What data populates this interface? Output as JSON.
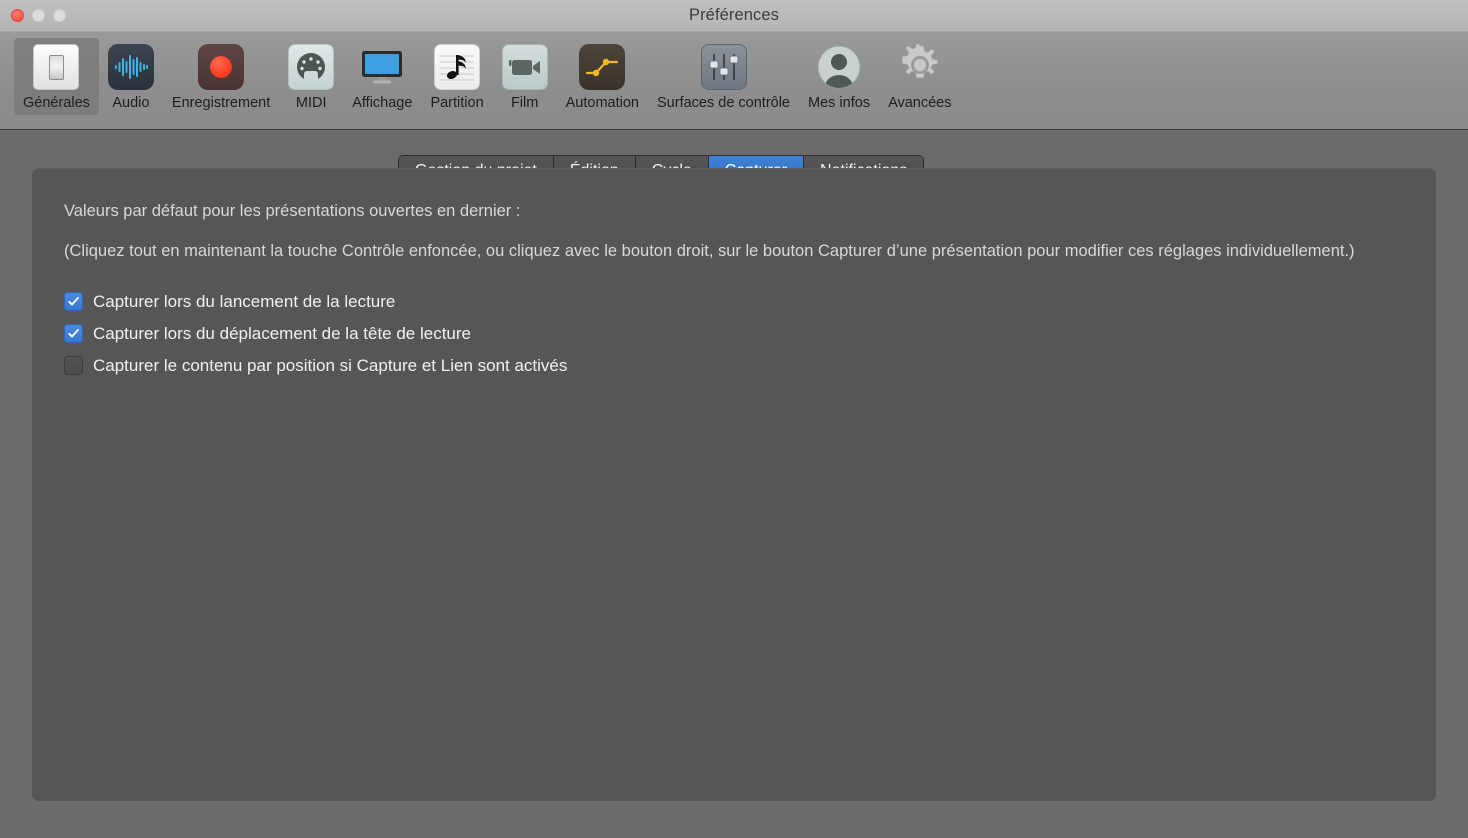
{
  "window": {
    "title": "Préférences",
    "controls": [
      {
        "name": "close",
        "icon": "close-button",
        "enabled": true
      },
      {
        "name": "minimize",
        "icon": "minimize-button",
        "enabled": false
      },
      {
        "name": "zoom",
        "icon": "maximize-button",
        "enabled": false
      }
    ]
  },
  "toolbar": {
    "items": [
      {
        "label": "Générales",
        "icon": "light-switch-icon",
        "selected": true
      },
      {
        "label": "Audio",
        "icon": "waveform-icon",
        "selected": false
      },
      {
        "label": "Enregistrement",
        "icon": "record-dot-icon",
        "selected": false
      },
      {
        "label": "MIDI",
        "icon": "midi-din-connector-icon",
        "selected": false
      },
      {
        "label": "Affichage",
        "icon": "display-monitor-icon",
        "selected": false
      },
      {
        "label": "Partition",
        "icon": "music-note-staff-icon",
        "selected": false
      },
      {
        "label": "Film",
        "icon": "video-camera-icon",
        "selected": false
      },
      {
        "label": "Automation",
        "icon": "automation-curve-icon",
        "selected": false
      },
      {
        "label": "Surfaces de contrôle",
        "icon": "faders-icon",
        "selected": false
      },
      {
        "label": "Mes infos",
        "icon": "user-avatar-icon",
        "selected": false
      },
      {
        "label": "Avancées",
        "icon": "gear-icon",
        "selected": false
      }
    ]
  },
  "tabs": [
    {
      "label": "Gestion du projet",
      "active": false
    },
    {
      "label": "Édition",
      "active": false
    },
    {
      "label": "Cycle",
      "active": false
    },
    {
      "label": "Capturer",
      "active": true
    },
    {
      "label": "Notifications",
      "active": false
    }
  ],
  "panel": {
    "lead": "Valeurs par défaut pour les présentations ouvertes en dernier :",
    "note": "(Cliquez tout en maintenant la touche Contrôle enfoncée, ou cliquez avec le bouton droit, sur le bouton Capturer d’une présentation pour modifier ces réglages individuellement.)",
    "checkboxes": [
      {
        "label": "Capturer lors du lancement de la lecture",
        "checked": true
      },
      {
        "label": "Capturer lors du déplacement de la tête de lecture",
        "checked": true
      },
      {
        "label": "Capturer le contenu par position si Capture et Lien sont activés",
        "checked": false
      }
    ]
  },
  "colors": {
    "titlebar": "#b8b8b8",
    "toolbar": "#909090",
    "window_background": "#6b6b6b",
    "panel": "#565656",
    "accent_blue": "#3878cf",
    "close_red": "#fc5f52",
    "text_light": "#f1f1f1",
    "text_muted": "#d8d8d8"
  }
}
